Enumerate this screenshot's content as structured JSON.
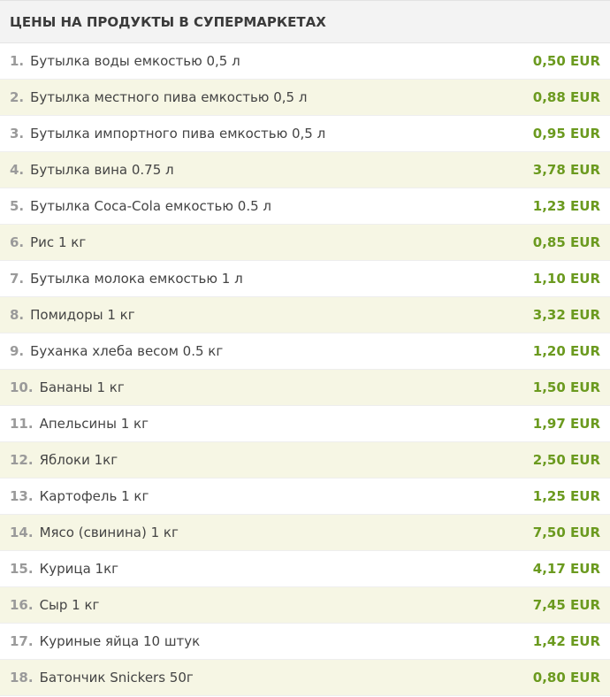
{
  "table": {
    "title": "ЦЕНЫ НА ПРОДУКТЫ В СУПЕРМАРКЕТАХ",
    "rows": [
      {
        "num": "1.",
        "name": "Бутылка воды емкостью 0,5 л",
        "price": "0,50 EUR"
      },
      {
        "num": "2.",
        "name": "Бутылка местного пива емкостью 0,5 л",
        "price": "0,88 EUR"
      },
      {
        "num": "3.",
        "name": "Бутылка импортного пива емкостью 0,5 л",
        "price": "0,95 EUR"
      },
      {
        "num": "4.",
        "name": "Бутылка вина 0.75 л",
        "price": "3,78 EUR"
      },
      {
        "num": "5.",
        "name": "Бутылка Coca-Cola емкостью 0.5 л",
        "price": "1,23 EUR"
      },
      {
        "num": "6.",
        "name": "Рис 1 кг",
        "price": "0,85 EUR"
      },
      {
        "num": "7.",
        "name": "Бутылка молока емкостью 1 л",
        "price": "1,10 EUR"
      },
      {
        "num": "8.",
        "name": "Помидоры 1 кг",
        "price": "3,32 EUR"
      },
      {
        "num": "9.",
        "name": "Буханка хлеба весом 0.5 кг",
        "price": "1,20 EUR"
      },
      {
        "num": "10.",
        "name": "Бананы 1 кг",
        "price": "1,50 EUR"
      },
      {
        "num": "11.",
        "name": "Апельсины 1 кг",
        "price": "1,97 EUR"
      },
      {
        "num": "12.",
        "name": "Яблоки 1кг",
        "price": "2,50 EUR"
      },
      {
        "num": "13.",
        "name": "Картофель 1 кг",
        "price": "1,25 EUR"
      },
      {
        "num": "14.",
        "name": "Мясо (свинина) 1 кг",
        "price": "7,50 EUR"
      },
      {
        "num": "15.",
        "name": "Курица 1кг",
        "price": "4,17 EUR"
      },
      {
        "num": "16.",
        "name": "Сыр 1 кг",
        "price": "7,45 EUR"
      },
      {
        "num": "17.",
        "name": "Куриные яйца 10 штук",
        "price": "1,42 EUR"
      },
      {
        "num": "18.",
        "name": "Батончик Snickers 50г",
        "price": "0,80 EUR"
      }
    ]
  },
  "colors": {
    "header_bg": "#f3f3f3",
    "row_alt_bg": "#f6f6e4",
    "price_green": "#6b9a1f",
    "number_gray": "#9a9a9a"
  }
}
